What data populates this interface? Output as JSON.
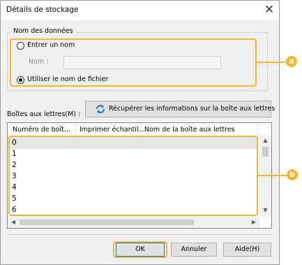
{
  "dialog": {
    "title": "Détails de stockage",
    "close_glyph": "✕"
  },
  "data_name_group": {
    "legend": "Nom des données",
    "option_enter_name": "Entrer un nom",
    "name_label": "Nom :",
    "name_value": "",
    "option_use_filename": "Utiliser le nom de fichier",
    "selected": "use_filename"
  },
  "mailboxes": {
    "label": "Boîtes aux lettres(M) :",
    "fetch_button": "Récupérer les informations sur la boîte aux lettres",
    "columns": [
      "Numéro de boît...",
      "Imprimer échantil...",
      "Nom de la boîte aux lettres"
    ],
    "rows": [
      "0",
      "1",
      "2",
      "3",
      "4",
      "5",
      "6"
    ]
  },
  "buttons": {
    "ok": "OK",
    "cancel": "Annuler",
    "help": "Aide(H)"
  },
  "callouts": {
    "a": "a",
    "b": "b"
  },
  "colors": {
    "accent": "#f5b62b",
    "selected_row": "#e5e5e5"
  },
  "icons": {
    "refresh": "refresh-icon"
  }
}
